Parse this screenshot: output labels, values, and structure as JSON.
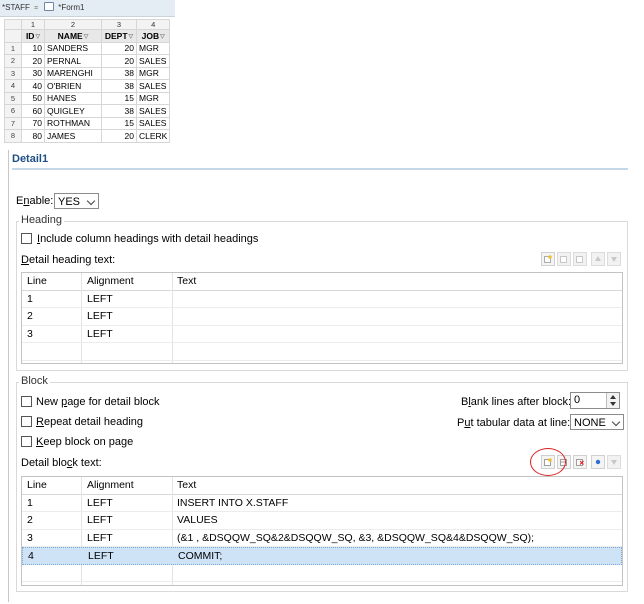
{
  "tabs": [
    {
      "label": "*STAFF",
      "close": "⌗"
    },
    {
      "label": "*Form1"
    }
  ],
  "grid": {
    "col_numbers": [
      "1",
      "2",
      "3",
      "4"
    ],
    "headers": [
      "ID",
      "NAME",
      "DEPT",
      "JOB"
    ],
    "rows": [
      {
        "n": "1",
        "id": "10",
        "name": "SANDERS",
        "dept": "20",
        "job": "MGR"
      },
      {
        "n": "2",
        "id": "20",
        "name": "PERNAL",
        "dept": "20",
        "job": "SALES"
      },
      {
        "n": "3",
        "id": "30",
        "name": "MARENGHI",
        "dept": "38",
        "job": "MGR"
      },
      {
        "n": "4",
        "id": "40",
        "name": "O'BRIEN",
        "dept": "38",
        "job": "SALES"
      },
      {
        "n": "5",
        "id": "50",
        "name": "HANES",
        "dept": "15",
        "job": "MGR"
      },
      {
        "n": "6",
        "id": "60",
        "name": "QUIGLEY",
        "dept": "38",
        "job": "SALES"
      },
      {
        "n": "7",
        "id": "70",
        "name": "ROTHMAN",
        "dept": "15",
        "job": "SALES"
      },
      {
        "n": "8",
        "id": "80",
        "name": "JAMES",
        "dept": "20",
        "job": "CLERK"
      }
    ]
  },
  "detail": {
    "title": "Detail1",
    "enable": {
      "label_pre": "E",
      "label_u": "n",
      "label_post": "able:",
      "value": "YES"
    },
    "heading": {
      "group_label": "Heading",
      "include_pre": "",
      "include_u": "I",
      "include_post": "nclude column headings with detail headings",
      "text_label_u": "D",
      "text_label_post": "etail heading text:",
      "columns": [
        "Line",
        "Alignment",
        "Text"
      ],
      "rows": [
        {
          "line": "1",
          "align": "LEFT",
          "text": ""
        },
        {
          "line": "2",
          "align": "LEFT",
          "text": ""
        },
        {
          "line": "3",
          "align": "LEFT",
          "text": ""
        }
      ]
    },
    "block": {
      "group_label": "Block",
      "new_page_pre": "New ",
      "new_page_u": "p",
      "new_page_post": "age for detail block",
      "repeat_u": "R",
      "repeat_post": "epeat detail heading",
      "keep_u": "K",
      "keep_post": "eep block on page",
      "blank_pre": "B",
      "blank_u": "l",
      "blank_post": "ank lines after block:",
      "blank_value": "0",
      "tabular_pre": "P",
      "tabular_u": "u",
      "tabular_post": "t tabular data at line:",
      "tabular_value": "NONE",
      "text_label_pre": "Detail blo",
      "text_label_u": "c",
      "text_label_post": "k text:",
      "columns": [
        "Line",
        "Alignment",
        "Text"
      ],
      "rows": [
        {
          "line": "1",
          "align": "LEFT",
          "text": "INSERT INTO X.STAFF"
        },
        {
          "line": "2",
          "align": "LEFT",
          "text": "VALUES"
        },
        {
          "line": "3",
          "align": "LEFT",
          "text": "(&1 , &DSQQW_SQ&2&DSQQW_SQ, &3, &DSQQW_SQ&4&DSQQW_SQ);"
        },
        {
          "line": "4",
          "align": "LEFT",
          "text": "COMMIT;"
        }
      ]
    }
  },
  "colors": {
    "accent": "#1f4f86",
    "selection": "#cfe3f7",
    "highlight_circle": "#d22222"
  }
}
